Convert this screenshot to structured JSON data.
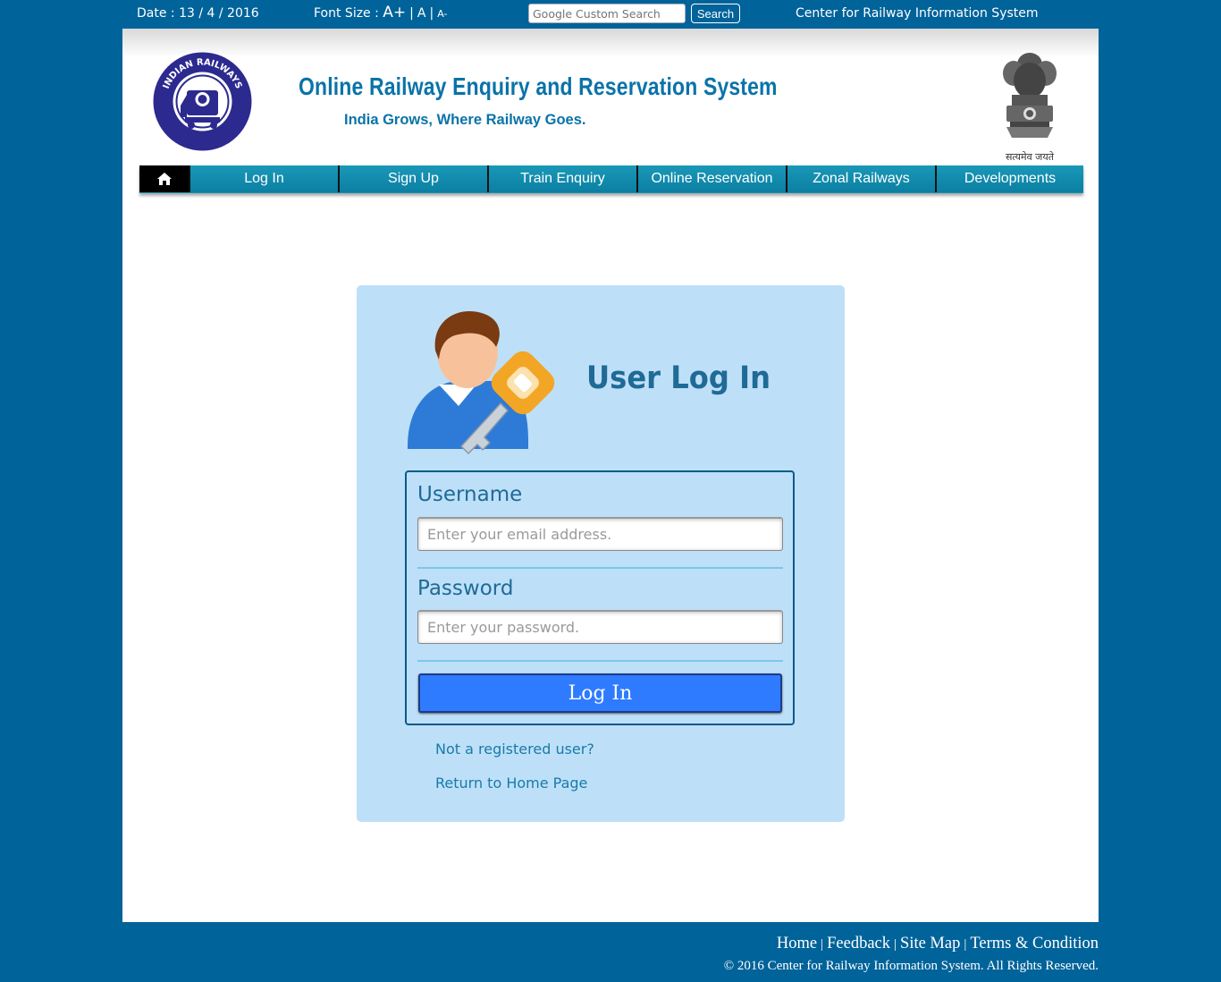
{
  "topbar": {
    "date": "Date : 13 / 4 / 2016",
    "font_size_label": "Font Size :",
    "font_increase": "A+",
    "font_normal": "A",
    "font_decrease": "A-",
    "search_placeholder": "Google Custom Search",
    "search_button": "Search",
    "org_name": "Center for Railway Information System"
  },
  "header": {
    "logo_text": "INDIAN RAILWAYS",
    "title": "Online Railway Enquiry and Reservation System",
    "tagline": "India Grows, Where Railway Goes.",
    "emblem_motto": "सत्यमेव जयते"
  },
  "nav": {
    "home_icon": "home-icon",
    "items": [
      {
        "label": "Log In"
      },
      {
        "label": "Sign Up"
      },
      {
        "label": "Train Enquiry"
      },
      {
        "label": "Online Reservation"
      },
      {
        "label": "Zonal Railways"
      },
      {
        "label": "Developments"
      }
    ]
  },
  "login": {
    "heading": "User Log In",
    "username_label": "Username",
    "username_placeholder": "Enter your email address.",
    "password_label": "Password",
    "password_placeholder": "Enter your password.",
    "submit_label": "Log In",
    "register_link": "Not a registered user?",
    "home_link": "Return to Home Page"
  },
  "footer": {
    "links": [
      "Home",
      "Feedback",
      "Site Map",
      "Terms & Condition"
    ],
    "copyright": "© 2016 Center for Railway Information System. All Rights Reserved."
  },
  "colors": {
    "page_bg": "#00639a",
    "nav_bg": "#1490b0",
    "card_bg": "#bde0f8",
    "accent_text": "#0a73a8",
    "button_bg": "#2e7bff"
  }
}
